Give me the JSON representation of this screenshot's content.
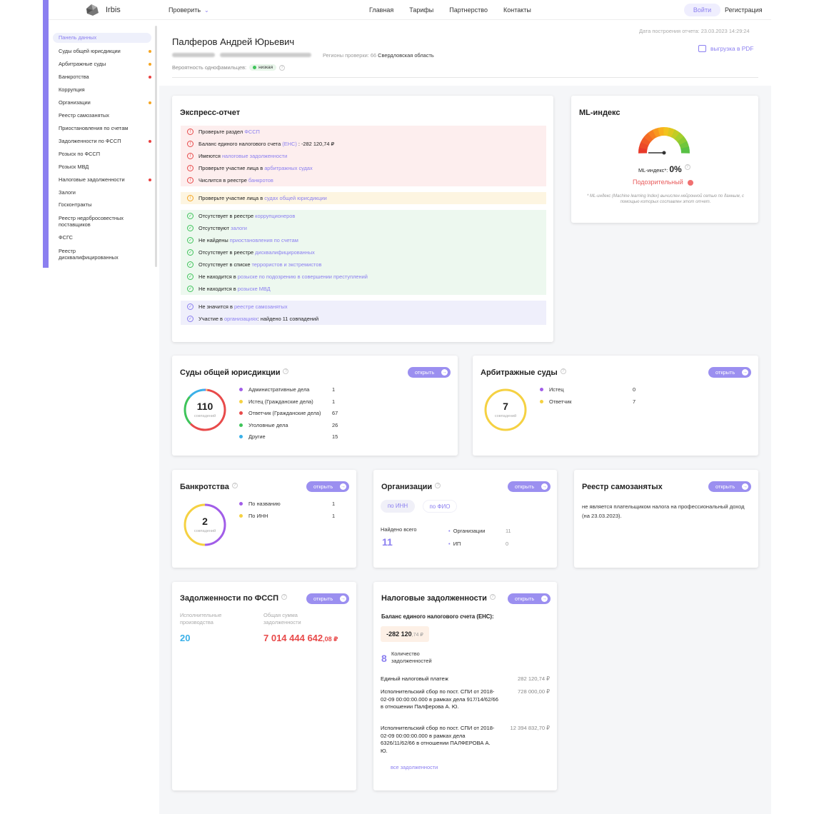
{
  "app": {
    "name": "Irbis"
  },
  "topbar": {
    "check_label": "Проверить",
    "nav": [
      "Главная",
      "Тарифы",
      "Партнерство",
      "Контакты"
    ],
    "login": "Войти",
    "register": "Регистрация"
  },
  "sidebar": {
    "items": [
      {
        "label": "Панель данных"
      },
      {
        "label": "Суды общей юрисдикции",
        "dot": "#f5a623"
      },
      {
        "label": "Арбитражные суды",
        "dot": "#f5a623"
      },
      {
        "label": "Банкротства",
        "dot": "#e84040"
      },
      {
        "label": "Коррупция"
      },
      {
        "label": "Организации",
        "dot": "#f5a623"
      },
      {
        "label": "Реестр самозанятых"
      },
      {
        "label": "Приостановления по счетам"
      },
      {
        "label": "Задолженности по ФССП",
        "dot": "#e84040"
      },
      {
        "label": "Розыск по ФССП"
      },
      {
        "label": "Розыск МВД"
      },
      {
        "label": "Налоговые задолженности",
        "dot": "#e84040"
      },
      {
        "label": "Залоги"
      },
      {
        "label": "Госконтракты"
      },
      {
        "label": "Реестр недобросовестных поставщиков"
      },
      {
        "label": "ФСГС"
      },
      {
        "label": "Реестр дисквалифицированных"
      }
    ]
  },
  "header": {
    "person_name": "Палферов Андрей Юрьевич",
    "regions_label": "Регионы проверки:",
    "regions_code": "66",
    "regions_value": "Свердловская область",
    "probability_label": "Вероятность однофамильцев:",
    "probability_value": "низкая",
    "report_date": "Дата построения отчета: 23.03.2023 14:29:24",
    "pdf_label": "выгрузка в PDF"
  },
  "express": {
    "title": "Экспресс-отчет",
    "red": [
      {
        "pre": "Проверьте раздел ",
        "link": "ФССП",
        "post": ""
      },
      {
        "pre": "Баланс единого налогового счета ",
        "link": "(ЕНС)",
        "post": " : -282 120,74 ₽"
      },
      {
        "pre": "Имеются ",
        "link": "налоговые задолженности",
        "post": ""
      },
      {
        "pre": "Проверьте участие лица в ",
        "link": "арбитражных судах",
        "post": ""
      },
      {
        "pre": "Числится в реестре ",
        "link": "банкротов",
        "post": ""
      }
    ],
    "yellow": [
      {
        "pre": "Проверьте участие лица в ",
        "link": "судах общей юрисдикции",
        "post": ""
      }
    ],
    "green": [
      {
        "pre": "Отсутствует в реестре ",
        "link": "коррупционеров",
        "post": ""
      },
      {
        "pre": "Отсутствуют ",
        "link": "залоги",
        "post": ""
      },
      {
        "pre": "Не найдены ",
        "link": "приостановления по счетам",
        "post": ""
      },
      {
        "pre": "Отсутствует в реестре ",
        "link": "дисквалифицированных",
        "post": ""
      },
      {
        "pre": "Отсутствует в списке ",
        "link": "террористов и экстремистов",
        "post": ""
      },
      {
        "pre": "Не находится в ",
        "link": "розыске по подозрению в совершении преступлений",
        "post": ""
      },
      {
        "pre": "Не находится в ",
        "link": "розыске МВД",
        "post": ""
      }
    ],
    "blue": [
      {
        "pre": "Не значится в ",
        "link": "реестре самозанятых",
        "post": ""
      },
      {
        "pre": "Участие в ",
        "link": "организациях",
        "post": ": найдено 11 совпадений"
      }
    ]
  },
  "ml": {
    "title": "ML-индекс",
    "label": "ML-индекс*:",
    "value": "0%",
    "status": "Подозрительный",
    "note": "* ML-индекс (Machine learning Index) вычислен нейронной сетью по данным, с помощью которых составлен этот отчет."
  },
  "courts": {
    "title": "Суды общей юрисдикции",
    "open": "открыть",
    "total": "110",
    "total_label": "совпадений",
    "items": [
      {
        "label": "Административные дела",
        "value": "1",
        "color": "#a15de8"
      },
      {
        "label": "Истец (Гражданские дела)",
        "value": "1",
        "color": "#f5d142"
      },
      {
        "label": "Ответчик (Гражданские дела)",
        "value": "67",
        "color": "#e84a4a"
      },
      {
        "label": "Уголовные дела",
        "value": "26",
        "color": "#3ec45a"
      },
      {
        "label": "Другие",
        "value": "15",
        "color": "#3ab0e8"
      }
    ]
  },
  "arbitr": {
    "title": "Арбитражные суды",
    "open": "открыть",
    "total": "7",
    "total_label": "совпадений",
    "items": [
      {
        "label": "Истец",
        "value": "0",
        "color": "#a15de8"
      },
      {
        "label": "Ответчик",
        "value": "7",
        "color": "#f5d142"
      }
    ]
  },
  "bankrupt": {
    "title": "Банкротства",
    "open": "открыть",
    "total": "2",
    "total_label": "совпадений",
    "items": [
      {
        "label": "По названию",
        "value": "1",
        "color": "#a15de8"
      },
      {
        "label": "По ИНН",
        "value": "1",
        "color": "#f5d142"
      }
    ]
  },
  "orgs": {
    "title": "Организации",
    "open": "открыть",
    "tab_inn": "по ИНН",
    "tab_fio": "по ФИО",
    "found_label": "Найдено всего",
    "found_value": "11",
    "items": [
      {
        "label": "Организации",
        "value": "11"
      },
      {
        "label": "ИП",
        "value": "0"
      }
    ]
  },
  "selfemp": {
    "title": "Реестр самозанятых",
    "open": "открыть",
    "text": "не является плательщиком налога на профессиональный доход (на 23.03.2023)."
  },
  "fssp": {
    "title": "Задолженности по ФССП",
    "open": "открыть",
    "col1_label": "Исполнительные производства",
    "col1_value": "20",
    "col2_label": "Общая сумма задолженности",
    "col2_value": "7 014 444 642",
    "col2_cents": ",08 ₽"
  },
  "tax": {
    "title": "Налоговые задолженности",
    "open": "открыть",
    "ens_label": "Баланс единого налогового счета (ЕНС):",
    "ens_value": "-282 120",
    "ens_cents": ",74 ₽",
    "count_value": "8",
    "count_label": "Количество задолженностей",
    "rows": [
      {
        "label": "Единый налоговый платеж",
        "value": "282 120,74 ₽"
      },
      {
        "label": "Исполнительский сбор по пост. СПИ от 2018-02-09 00:00:00.000 в рамках дела 917/14/62/66 в отношении Палферова А. Ю.",
        "value": "728 000,00 ₽"
      },
      {
        "label": "Исполнительский сбор по пост. СПИ от 2018-02-09 00:00:00.000 в рамках дела 6326/11/62/66 в отношении ПАЛФЕРОВА А. Ю.",
        "value": "12 394 832,70 ₽"
      }
    ],
    "all_link": "все задолженности"
  }
}
